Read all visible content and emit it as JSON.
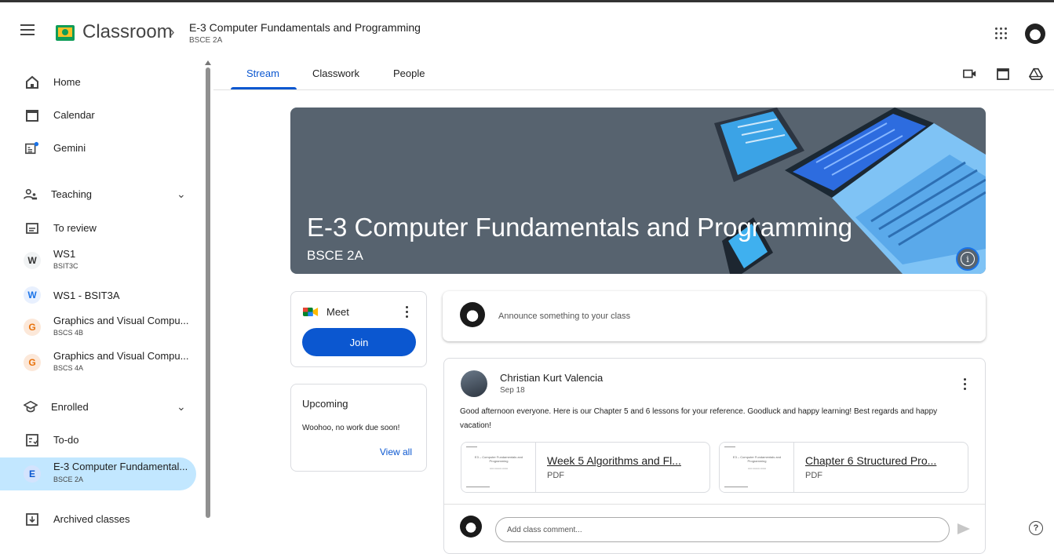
{
  "header": {
    "app_name": "Classroom",
    "breadcrumb_title": "E-3 Computer Fundamentals and Programming",
    "breadcrumb_sub": "BSCE 2A"
  },
  "sidebar": {
    "home": "Home",
    "calendar": "Calendar",
    "gemini": "Gemini",
    "teaching": "Teaching",
    "to_review": "To review",
    "classes_teaching": [
      {
        "letter": "W",
        "name": "WS1",
        "section": "BSIT3C",
        "color": "#333333",
        "bg": "#f1f3f4"
      },
      {
        "letter": "W",
        "name": "WS1 - BSIT3A",
        "section": "",
        "color": "#1a73e8",
        "bg": "#e8f0fe"
      },
      {
        "letter": "G",
        "name": "Graphics and Visual Compu...",
        "section": "BSCS 4B",
        "color": "#e8710a",
        "bg": "#fce8d9"
      },
      {
        "letter": "G",
        "name": "Graphics and Visual Compu...",
        "section": "BSCS 4A",
        "color": "#e8710a",
        "bg": "#fce8d9"
      }
    ],
    "enrolled": "Enrolled",
    "todo": "To-do",
    "enrolled_class": {
      "letter": "E",
      "name": "E-3 Computer Fundamental...",
      "section": "BSCE 2A"
    },
    "archived": "Archived classes"
  },
  "tabs": [
    "Stream",
    "Classwork",
    "People"
  ],
  "banner": {
    "title": "E-3 Computer Fundamentals and Programming",
    "section": "BSCE 2A",
    "info_glyph": "i"
  },
  "meet": {
    "title": "Meet",
    "join_label": "Join"
  },
  "upcoming": {
    "title": "Upcoming",
    "text": "Woohoo, no work due soon!",
    "link": "View all"
  },
  "announce": {
    "placeholder": "Announce something to your class"
  },
  "post": {
    "author": "Christian Kurt Valencia",
    "date": "Sep 18",
    "body": "Good afternoon everyone. Here is our Chapter 5 and 6 lessons for your reference. Goodluck and happy learning! Best regards and happy vacation!",
    "attachments": [
      {
        "title": "Week 5 Algorithms and Fl...",
        "type": "PDF"
      },
      {
        "title": "Chapter 6 Structured Pro...",
        "type": "PDF"
      }
    ],
    "comment_placeholder": "Add class comment..."
  },
  "colors": {
    "accent": "#0b57d0",
    "active_nav": "#c2e7ff",
    "banner_bg": "#57636f"
  }
}
